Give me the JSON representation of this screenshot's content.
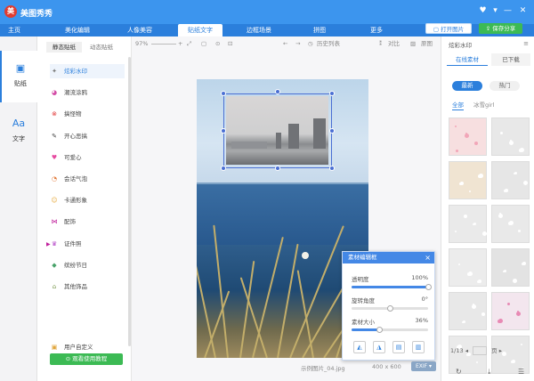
{
  "app": {
    "title": "美图秀秀"
  },
  "window_controls": {
    "skin_icon": "♥",
    "menu_icon": "▾",
    "minimize_icon": "—",
    "close_icon": "✕"
  },
  "tabs": [
    {
      "label": "主页"
    },
    {
      "label": "美化编辑"
    },
    {
      "label": "人像美容"
    },
    {
      "label": "贴纸文字"
    },
    {
      "label": "边框场景"
    },
    {
      "label": "拼图"
    },
    {
      "label": "更多"
    }
  ],
  "header_buttons": {
    "open_label": "打开图片",
    "save_label": "保存分享"
  },
  "rail": {
    "sticker_label": "贴纸",
    "text_label": "文字"
  },
  "category_panel": {
    "subtabs": [
      "静态贴纸",
      "动态贴纸"
    ],
    "items": [
      {
        "label": "炫彩水印",
        "icon": "✦",
        "color": "#7a7a7a"
      },
      {
        "label": "潮流涂鸦",
        "icon": "◕",
        "color": "#d34ca6"
      },
      {
        "label": "搞怪物",
        "icon": "⊗",
        "color": "#e23b3b"
      },
      {
        "label": "开心恶搞",
        "icon": "✎",
        "color": "#444444"
      },
      {
        "label": "可爱心",
        "icon": "♥",
        "color": "#e64aa0"
      },
      {
        "label": "会话气泡",
        "icon": "◔",
        "color": "#e27a3b"
      },
      {
        "label": "卡通形象",
        "icon": "☺",
        "color": "#e6a93b"
      },
      {
        "label": "配饰",
        "icon": "⋈",
        "color": "#c0209c"
      },
      {
        "label": "证件照",
        "icon": "♛",
        "color": "#b548c8"
      },
      {
        "label": "缤纷节日",
        "icon": "◆",
        "color": "#4aa36b"
      },
      {
        "label": "其他饰品",
        "icon": "⌂",
        "color": "#7d9a54"
      },
      {
        "label": "用户自定义",
        "icon": "▣",
        "color": "#e0a53b"
      }
    ],
    "tutorial_label": "观看使用教程"
  },
  "canvas_toolbar": {
    "zoom": "97%",
    "history_label": "历史列表",
    "compare_label": "对比",
    "original_label": "原图"
  },
  "edit_box": {
    "title": "素材编辑框",
    "opacity_label": "透明度",
    "opacity_value": "100%",
    "opacity": 1.0,
    "rotation_label": "旋转角度",
    "rotation_value": "0°",
    "rotation": 0.5,
    "size_label": "素材大小",
    "size_value": "36%",
    "size": 0.36
  },
  "status": {
    "filename": "示例图片_04.jpg",
    "size": "400 x 600",
    "exif": "EXIF"
  },
  "right_panel": {
    "title": "炫彩水印",
    "tabs": [
      "在线素材",
      "已下载"
    ],
    "pills": [
      "最新",
      "热门"
    ],
    "filters": [
      "全部",
      "冰雪girl"
    ],
    "page": "1/13",
    "page_suffix": "页"
  },
  "colors": {
    "brand": "#3c95ee",
    "tabbar": "#2b7fdc",
    "save_green": "#3cba54"
  }
}
